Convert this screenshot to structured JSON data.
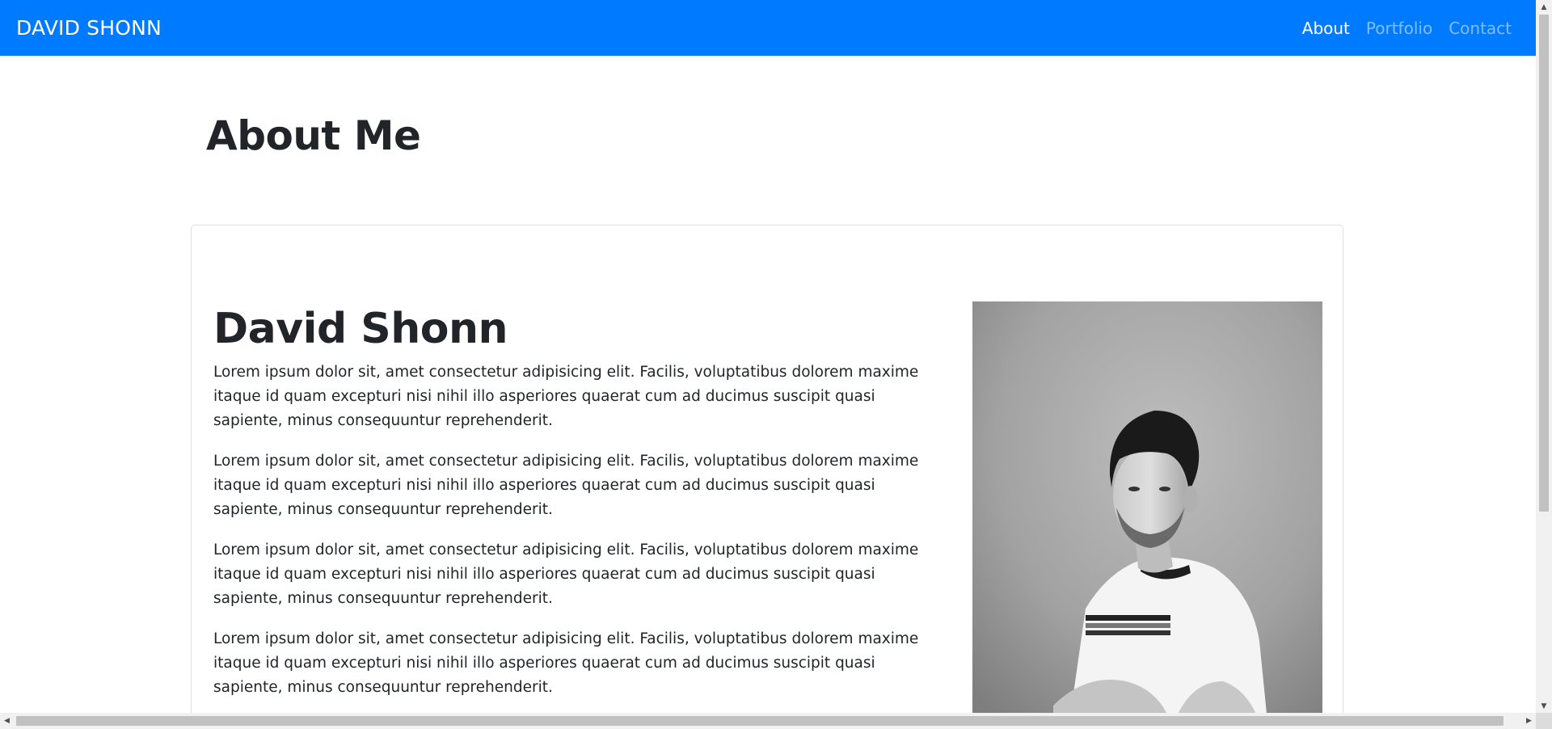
{
  "navbar": {
    "brand": "DAVID SHONN",
    "links": [
      {
        "label": "About"
      },
      {
        "label": "Portfolio"
      },
      {
        "label": "Contact"
      }
    ]
  },
  "page": {
    "title": "About Me"
  },
  "card": {
    "name": "David Shonn",
    "paragraphs": [
      "Lorem ipsum dolor sit, amet consectetur adipisicing elit. Facilis, voluptatibus dolorem maxime itaque id quam excepturi nisi nihil illo asperiores quaerat cum ad ducimus suscipit quasi sapiente, minus consequuntur reprehenderit.",
      "Lorem ipsum dolor sit, amet consectetur adipisicing elit. Facilis, voluptatibus dolorem maxime itaque id quam excepturi nisi nihil illo asperiores quaerat cum ad ducimus suscipit quasi sapiente, minus consequuntur reprehenderit.",
      "Lorem ipsum dolor sit, amet consectetur adipisicing elit. Facilis, voluptatibus dolorem maxime itaque id quam excepturi nisi nihil illo asperiores quaerat cum ad ducimus suscipit quasi sapiente, minus consequuntur reprehenderit.",
      "Lorem ipsum dolor sit, amet consectetur adipisicing elit. Facilis, voluptatibus dolorem maxime itaque id quam excepturi nisi nihil illo asperiores quaerat cum ad ducimus suscipit quasi sapiente, minus consequuntur reprehenderit."
    ]
  },
  "colors": {
    "navbar": "#007bff",
    "text": "#212529",
    "nav_inactive": "rgba(255,255,255,0.5)"
  },
  "icons": {
    "scroll_up": "triangle-up-icon",
    "scroll_down": "triangle-down-icon",
    "scroll_left": "triangle-left-icon",
    "scroll_right": "triangle-right-icon"
  }
}
